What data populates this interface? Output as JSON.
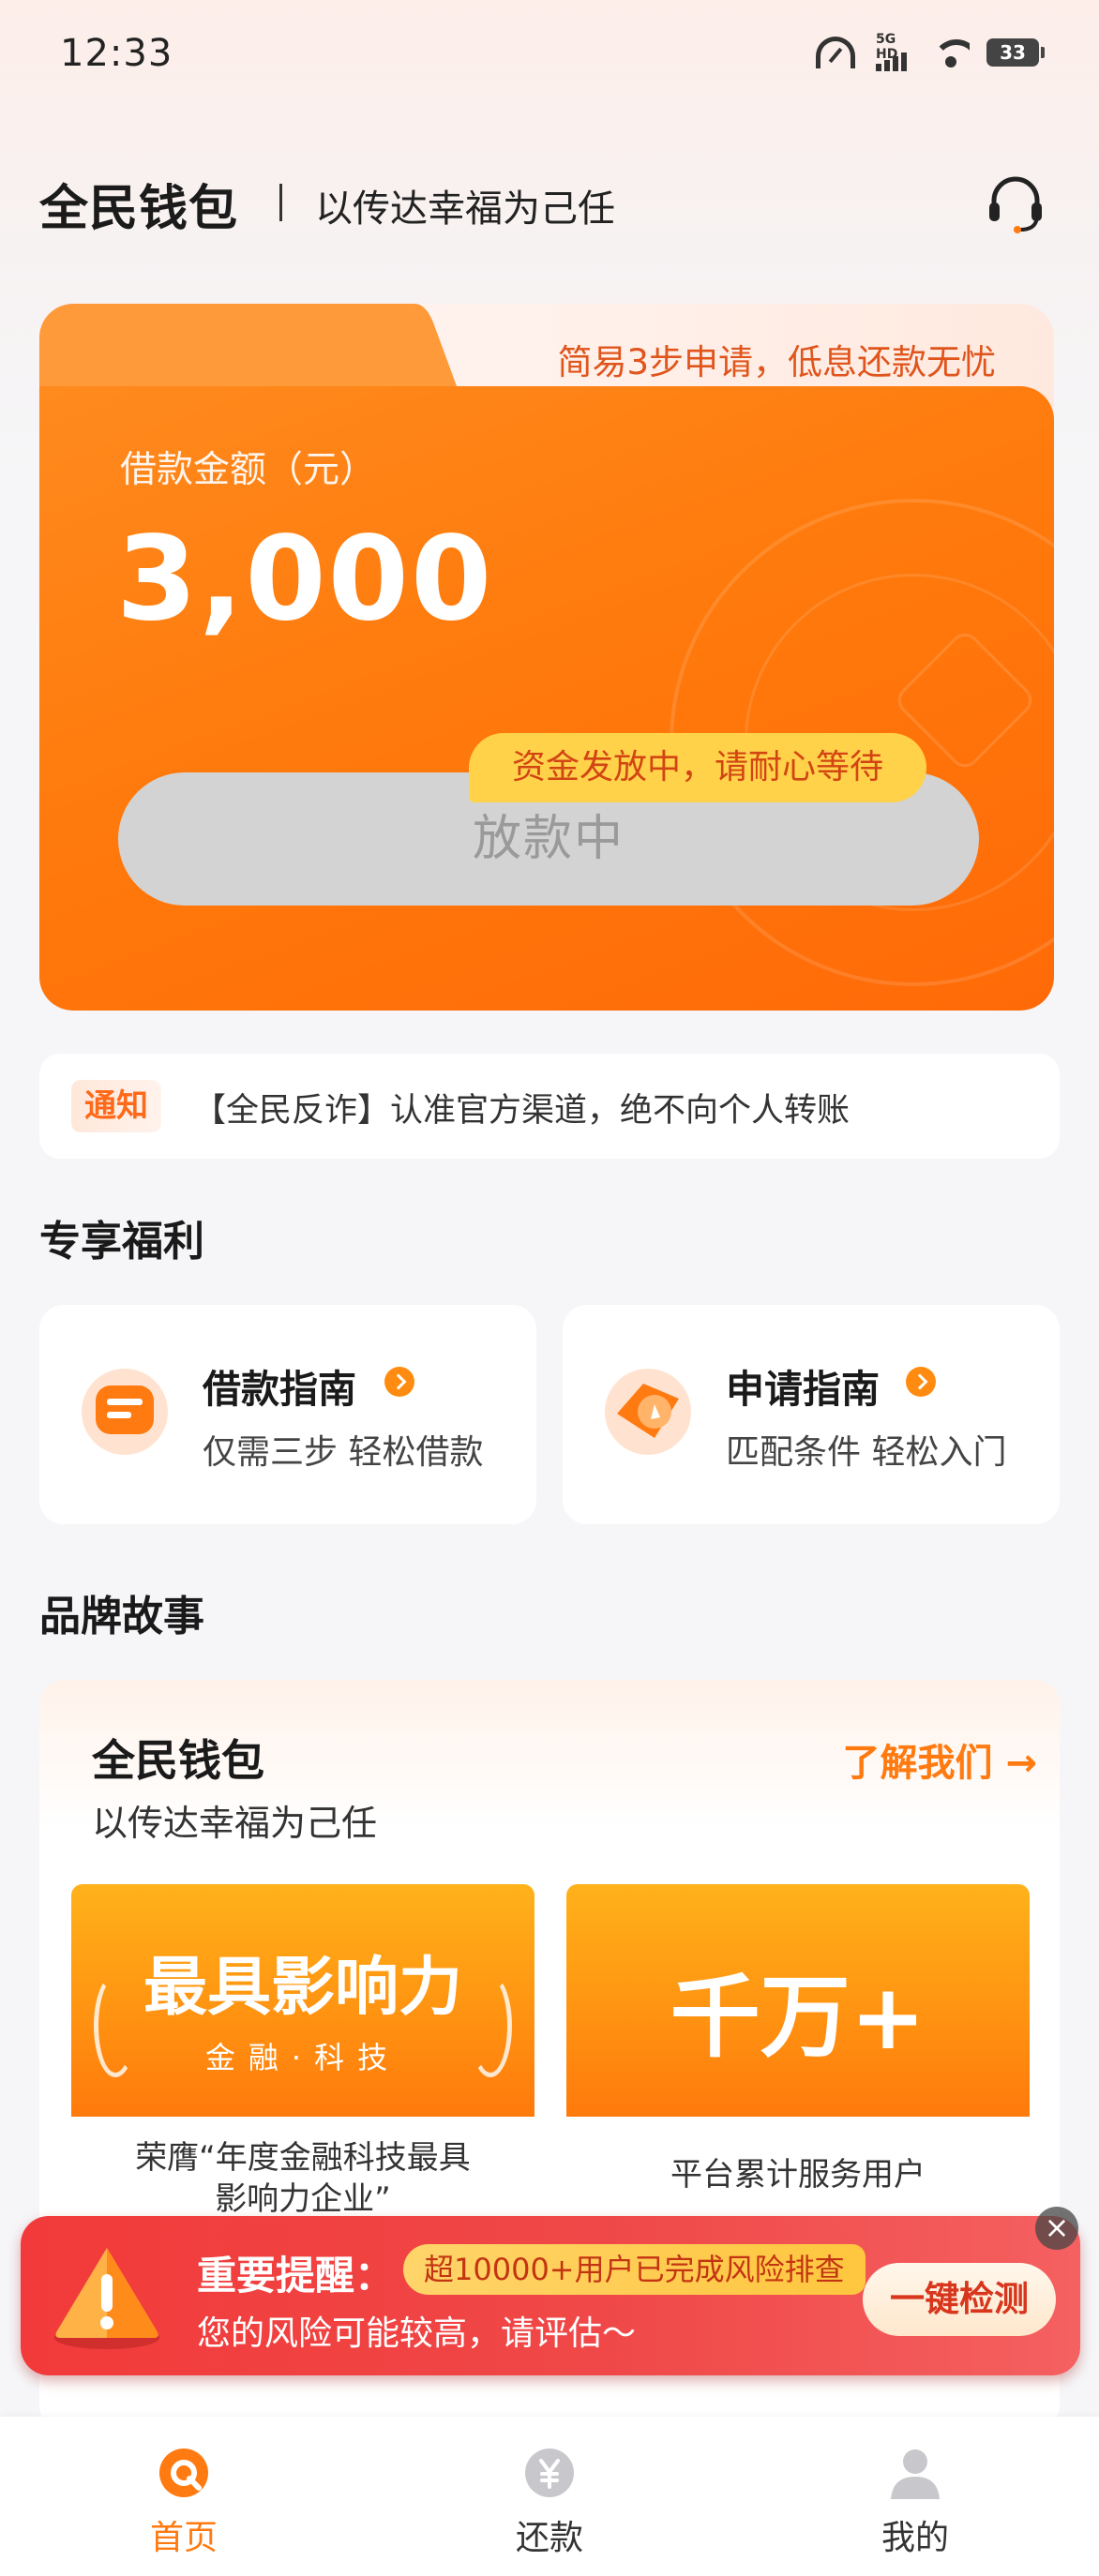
{
  "status_bar": {
    "time": "12:33",
    "network": "5G HD",
    "battery": "33"
  },
  "header": {
    "app_name": "全民钱包",
    "slogan": "以传达幸福为己任"
  },
  "loan_card": {
    "tab_text": "简易3步申请，低息还款无忧",
    "amount_label": "借款金额（元）",
    "amount_value": "3,000",
    "status_tip": "资金发放中，请耐心等待",
    "status_button": "放款中"
  },
  "notice": {
    "tag": "通知",
    "text": "【全民反诈】认准官方渠道，绝不向个人转账"
  },
  "benefits": {
    "section_title": "专享福利",
    "items": [
      {
        "title": "借款指南",
        "desc": "仅需三步 轻松借款"
      },
      {
        "title": "申请指南",
        "desc": "匹配条件 轻松入门"
      }
    ]
  },
  "brand_story": {
    "section_title": "品牌故事",
    "name": "全民钱包",
    "slogan": "以传达幸福为己任",
    "learn_more": "了解我们 →",
    "tiles": [
      {
        "headline": "最具影响力",
        "sub": "金融·科技",
        "caption_line1": "荣膺“年度金融科技最具",
        "caption_line2": "影响力企业”"
      },
      {
        "headline": "千万+",
        "caption_line1": "平台累计服务用户"
      }
    ]
  },
  "risk_alert": {
    "title": "重要提醒：",
    "badge": "超10000+用户已完成风险排查",
    "desc": "您的风险可能较高，请评估～",
    "cta": "一键检测",
    "close": "×"
  },
  "bottom_nav": {
    "items": [
      {
        "label": "首页",
        "icon": "home-icon",
        "active": true
      },
      {
        "label": "还款",
        "icon": "repay-icon",
        "active": false
      },
      {
        "label": "我的",
        "icon": "profile-icon",
        "active": false
      }
    ]
  },
  "colors": {
    "accent": "#ff7a10",
    "card_orange": "#ff7a0c",
    "alert_red": "#f23a3a",
    "tip_yellow": "#ffd24a"
  }
}
